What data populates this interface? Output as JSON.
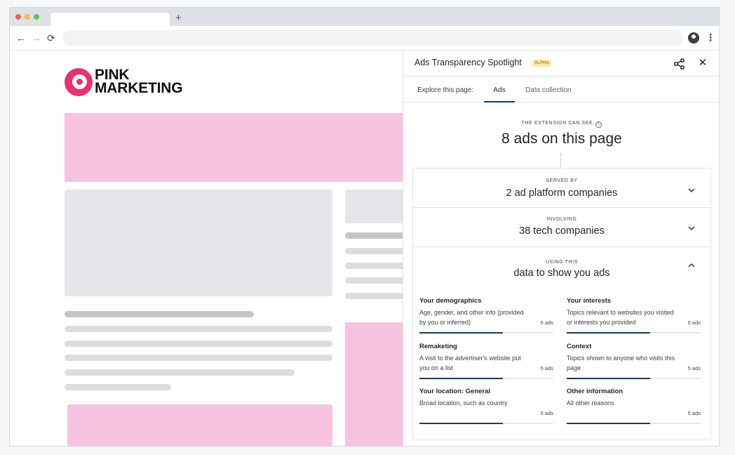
{
  "browser": {
    "new_tab_glyph": "+",
    "nav": {
      "back": "←",
      "forward": "→",
      "reload": "⟳"
    },
    "menu_glyph": "⋮"
  },
  "site": {
    "logo_line1": "PINK",
    "logo_line2": "MARKETING",
    "colors": {
      "brand": "#e6336b",
      "ad_placeholder": "#f7c3e0",
      "content_placeholder": "#e5e6e9"
    }
  },
  "panel": {
    "title": "Ads Transparency Spotlight",
    "badge": "ALPHA",
    "close_glyph": "✕",
    "explore_label": "Explore this page:",
    "tabs": [
      {
        "label": "Ads",
        "active": true
      },
      {
        "label": "Data collection",
        "active": false
      }
    ],
    "can_see_label": "THE EXTENSION CAN SEE",
    "info_glyph": "i",
    "headline": "8 ads on this page",
    "sections": [
      {
        "label": "SERVED BY",
        "value": "2 ad platform companies",
        "expanded": false
      },
      {
        "label": "INVOLVING",
        "value": "38 tech companies",
        "expanded": false
      },
      {
        "label": "USING THIS",
        "value": "data to show you ads",
        "expanded": true
      }
    ],
    "categories": [
      {
        "title": "Your demographics",
        "desc": "Age, gender, and other info (provided by you or inferred)",
        "count": "5 ads",
        "fraction": 0.625
      },
      {
        "title": "Your interests",
        "desc": "Topics relevant to websites you visited or interests you provided",
        "count": "5 ads",
        "fraction": 0.625
      },
      {
        "title": "Remaketing",
        "desc": "A visit to the advertiser's website put you on a list",
        "count": "5 ads",
        "fraction": 0.625
      },
      {
        "title": "Context",
        "desc": "Topics shown to anyone who visits this page",
        "count": "5 ads",
        "fraction": 0.625
      },
      {
        "title": "Your location: General",
        "desc": "Broad location, such as country",
        "count": "5 ads",
        "fraction": 0.625
      },
      {
        "title": "Other information",
        "desc": "All other reasons",
        "count": "5 ads",
        "fraction": 0.625
      }
    ],
    "colors": {
      "accent": "#1f3b57",
      "badge_bg": "#fde9a6"
    }
  }
}
